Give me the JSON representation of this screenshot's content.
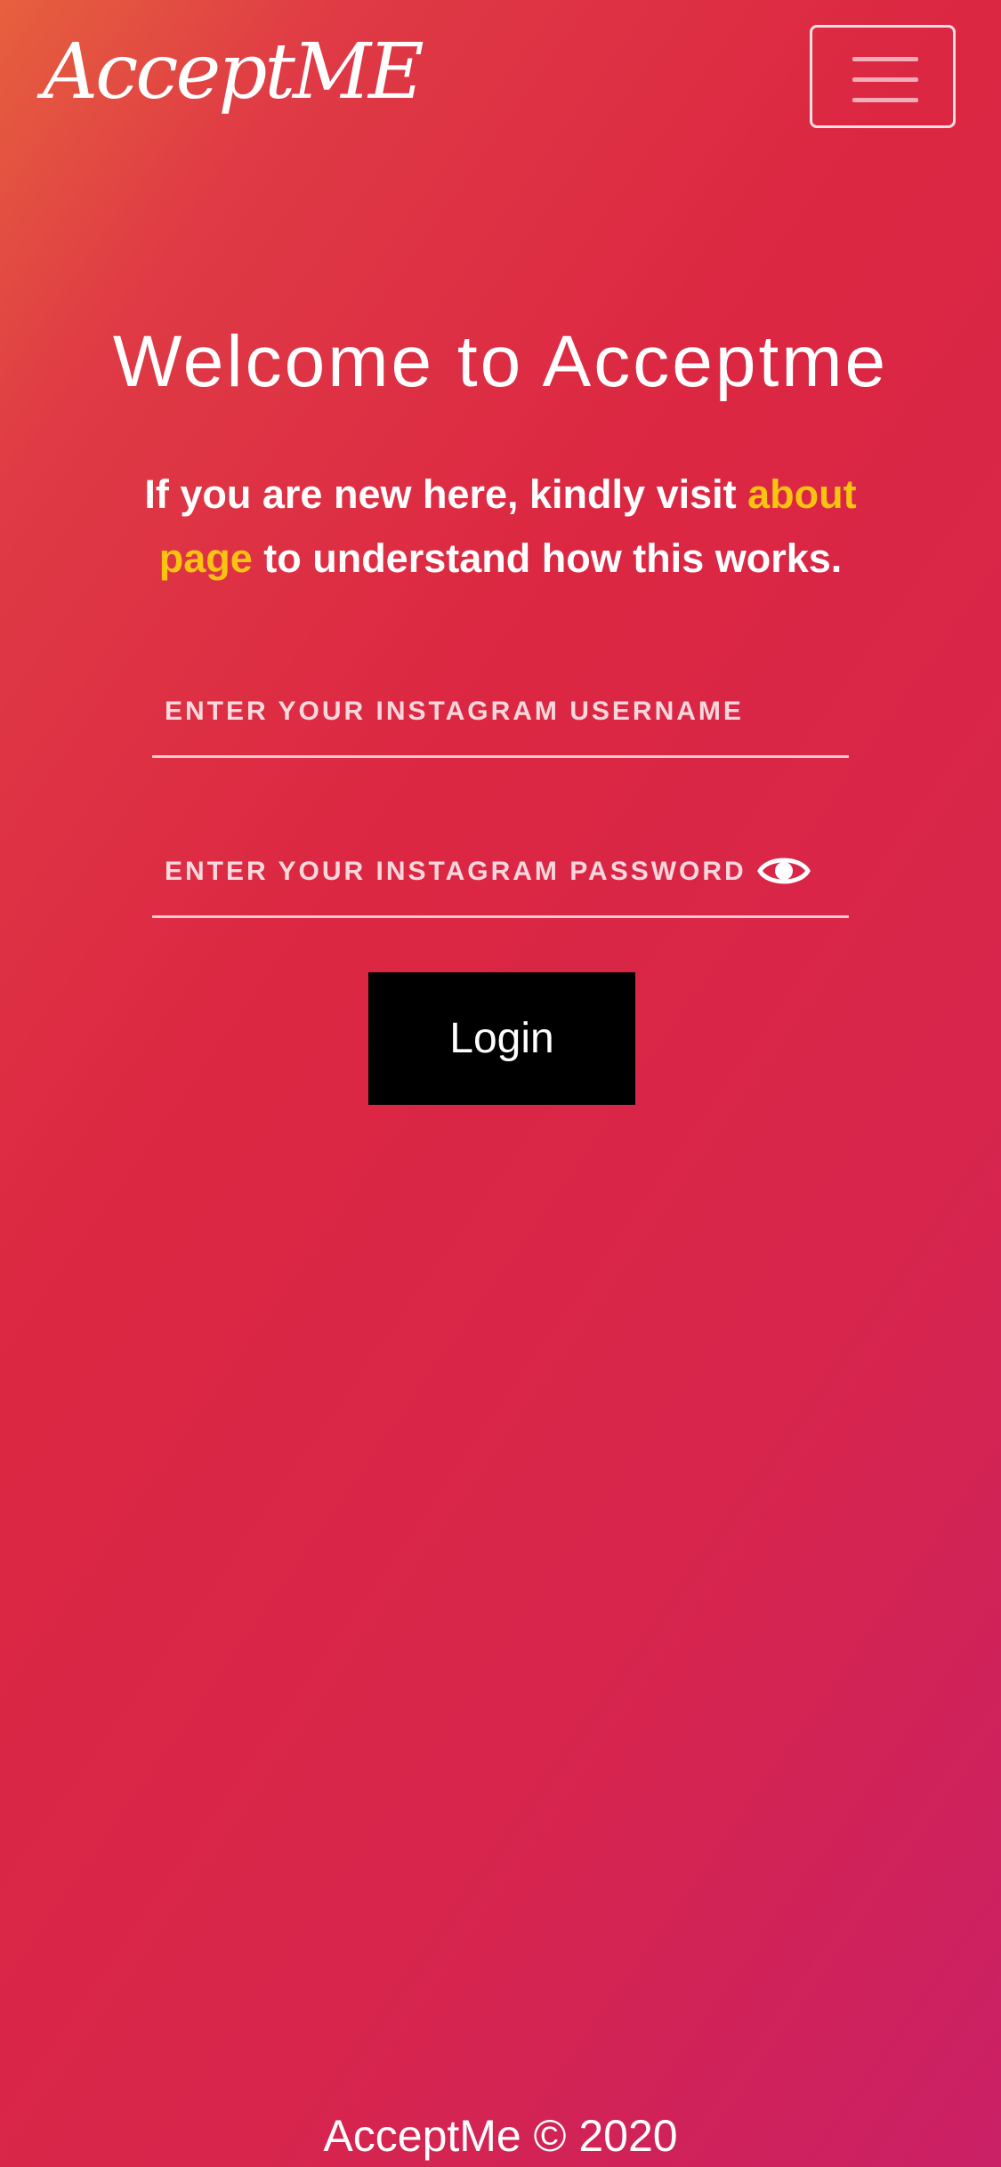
{
  "header": {
    "brand": "AcceptME",
    "menu_icon": "hamburger-menu-icon"
  },
  "main": {
    "title": "Welcome to Acceptme",
    "intro_before": "If you are new here, kindly visit ",
    "intro_link": "about page",
    "intro_after": " to understand how this works.",
    "username_placeholder": "ENTER YOUR INSTAGRAM USERNAME",
    "password_placeholder": "ENTER YOUR INSTAGRAM PASSWORD",
    "username_value": "",
    "password_value": "",
    "password_toggle_icon": "eye-icon",
    "login_label": "Login"
  },
  "footer": {
    "text": "AcceptMe © 2020"
  },
  "colors": {
    "gradient_start": "#e6603e",
    "gradient_mid": "#dc2742",
    "gradient_end": "#ca2066",
    "link": "#f9c312",
    "button": "#000000",
    "text": "#ffffff"
  }
}
